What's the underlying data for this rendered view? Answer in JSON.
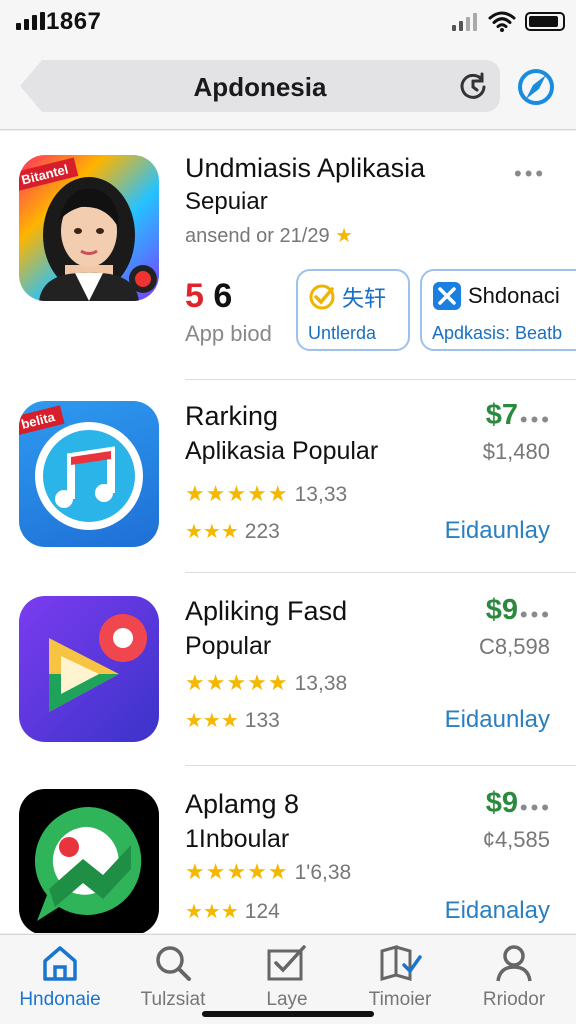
{
  "status": {
    "time": "1867"
  },
  "search": {
    "title": "Apdonesia"
  },
  "featured": {
    "icon_ribbon": "Bitantel",
    "title": "Undmiasis Aplikasia",
    "subtitle": "Sepuiar",
    "rating_text": "ansend or 21/29",
    "rank_number_red": "5",
    "rank_number": "6",
    "rank_label": "App biod",
    "chips": [
      {
        "top": "失轩",
        "bottom": "Untlerda"
      },
      {
        "top": "Shdonaci",
        "bottom": "Apdkasis: Beatb"
      }
    ]
  },
  "apps": [
    {
      "ribbon": "belita",
      "title": "Rarking",
      "subtitle": "Aplikasia Popular",
      "stars": "★★★★★",
      "count": "13,33",
      "stars2": "★★★",
      "count2": "223",
      "price": "$7",
      "old_price": "$1,480",
      "action": "Eidaunlay"
    },
    {
      "ribbon": "",
      "title": "Apliking Fasd",
      "subtitle": "Popular",
      "stars": "★★★★★",
      "count": "13,38",
      "stars2": "★★★",
      "count2": "133",
      "price": "$9",
      "old_price": "C8,598",
      "action": "Eidaunlay"
    },
    {
      "ribbon": "",
      "title": "Aplamg 8",
      "subtitle": "1Inboular",
      "stars": "★★★★★",
      "count": "1'6,38",
      "stars2": "★★★",
      "count2": "124",
      "price": "$9",
      "old_price": "¢4,585",
      "action": "Eidanalay"
    }
  ],
  "tabs": [
    {
      "label": "Hndonaie",
      "icon": "home-icon",
      "active": true
    },
    {
      "label": "Tulzsiat",
      "icon": "search-icon"
    },
    {
      "label": "Laye",
      "icon": "checklist-icon"
    },
    {
      "label": "Timoier",
      "icon": "book-icon"
    },
    {
      "label": "Rriodor",
      "icon": "person-icon"
    }
  ],
  "colors": {
    "accent": "#1a75d1",
    "price_green": "#2a8a3e",
    "star": "#f5b800",
    "rank_red": "#e0242b"
  }
}
